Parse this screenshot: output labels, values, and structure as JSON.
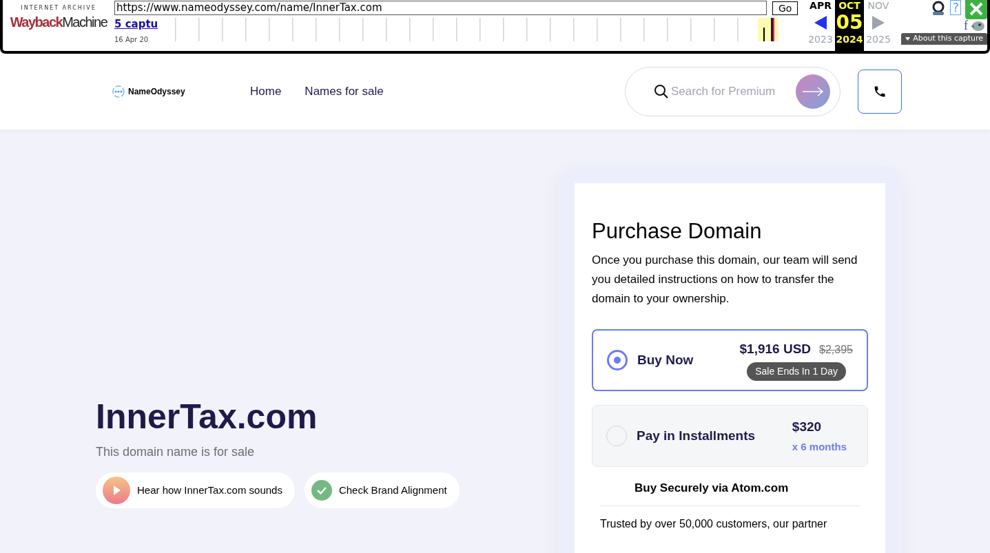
{
  "wayback": {
    "logo_top": "INTERNET ARCHIVE",
    "logo_left": "Wayback",
    "logo_right": "Machine",
    "url": "https://www.nameodyssey.com/name/InnerTax.com",
    "go": "Go",
    "captures": "5 captu",
    "first_date": "16 Apr 20",
    "months": [
      {
        "label": "APR",
        "selected": false
      },
      {
        "label": "OCT",
        "selected": true
      },
      {
        "label": "NOV",
        "selected": false
      }
    ],
    "day": "05",
    "years": [
      {
        "label": "2023",
        "selected": false
      },
      {
        "label": "2024",
        "selected": true
      },
      {
        "label": "2025",
        "selected": false
      }
    ],
    "about": "About this capture",
    "facebook": "f",
    "help": "?"
  },
  "header": {
    "brand": "NameOdyssey",
    "nav": [
      "Home",
      "Names for sale"
    ],
    "search": {
      "placeholder": "Search for Premium"
    }
  },
  "hero": {
    "title": "InnerTax.com",
    "subtitle": "This domain name is for sale",
    "actions": [
      {
        "kind": "play",
        "label": "Hear how InnerTax.com sounds"
      },
      {
        "kind": "check",
        "label": "Check Brand Alignment"
      }
    ]
  },
  "purchase": {
    "title": "Purchase Domain",
    "text": "Once you purchase this domain, our team will send you detailed instructions on how to transfer the domain to your ownership.",
    "options": [
      {
        "kind": "buy",
        "label": "Buy Now",
        "price": "$1,916 USD",
        "old_price": "$2,395",
        "badge": "Sale Ends In 1 Day",
        "selected": true
      },
      {
        "kind": "installments",
        "label": "Pay in Installments",
        "price": "$320",
        "period": "x 6 months",
        "selected": false
      }
    ],
    "secure": "Buy Securely via Atom.com",
    "trust": "Trusted by over 50,000 customers, our partner"
  }
}
